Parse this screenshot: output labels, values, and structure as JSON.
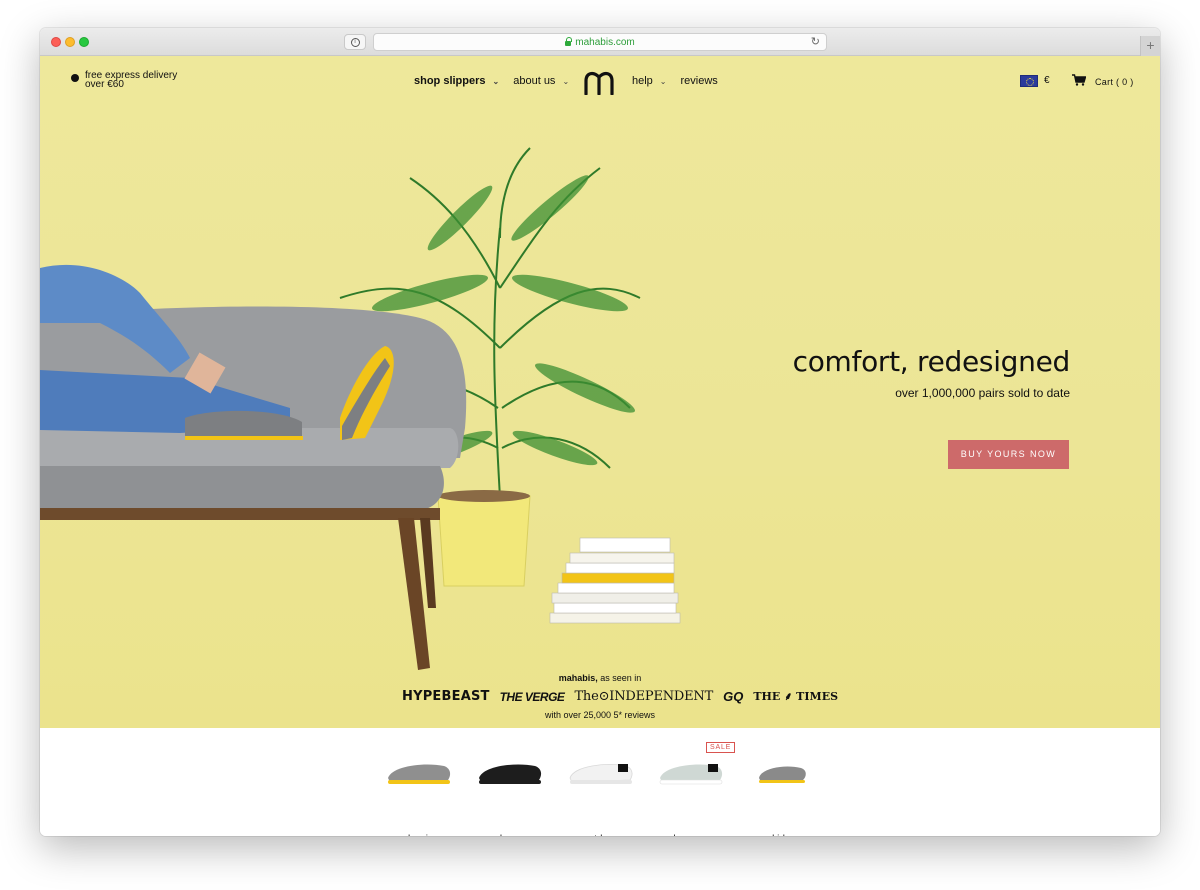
{
  "browser": {
    "url": "mahabis.com"
  },
  "nav": {
    "delivery": [
      "free express delivery",
      "over €60"
    ],
    "shop_slippers": "shop slippers",
    "about_us": "about us",
    "help": "help",
    "reviews": "reviews",
    "currency": "€",
    "cart": "Cart ( 0 )"
  },
  "hero": {
    "headline": "comfort, redesigned",
    "subline": "over 1,000,000 pairs sold to date",
    "cta": "BUY YOURS NOW"
  },
  "press": {
    "title_brand": "mahabis,",
    "title_rest": " as seen in",
    "logos": [
      "HYPEBEAST",
      "THE VERGE",
      "The⊙INDEPENDENT",
      "GQ",
      "THE ⸙ TIMES"
    ],
    "reviews": "with over 25,000 5* reviews"
  },
  "products": {
    "sale_badge": "SALE",
    "items": [
      {
        "label": "classic",
        "body": "#8f8f8f",
        "sole": "#f2c417"
      },
      {
        "label": "luxe",
        "body": "#1d1d1d",
        "sole": "#1d1d1d"
      },
      {
        "label": "outdoor",
        "body": "#f2f2f2",
        "sole": "#e6e6e6"
      },
      {
        "label": "clearance",
        "body": "#cfd8d4",
        "sole": "#ffffff"
      },
      {
        "label": "kids",
        "body": "#8a8a8a",
        "sole": "#f2c417"
      }
    ]
  },
  "colors": {
    "hero_bg": "#eee89b",
    "cta_bg": "#cd6a6a",
    "sale": "#d9534f"
  }
}
